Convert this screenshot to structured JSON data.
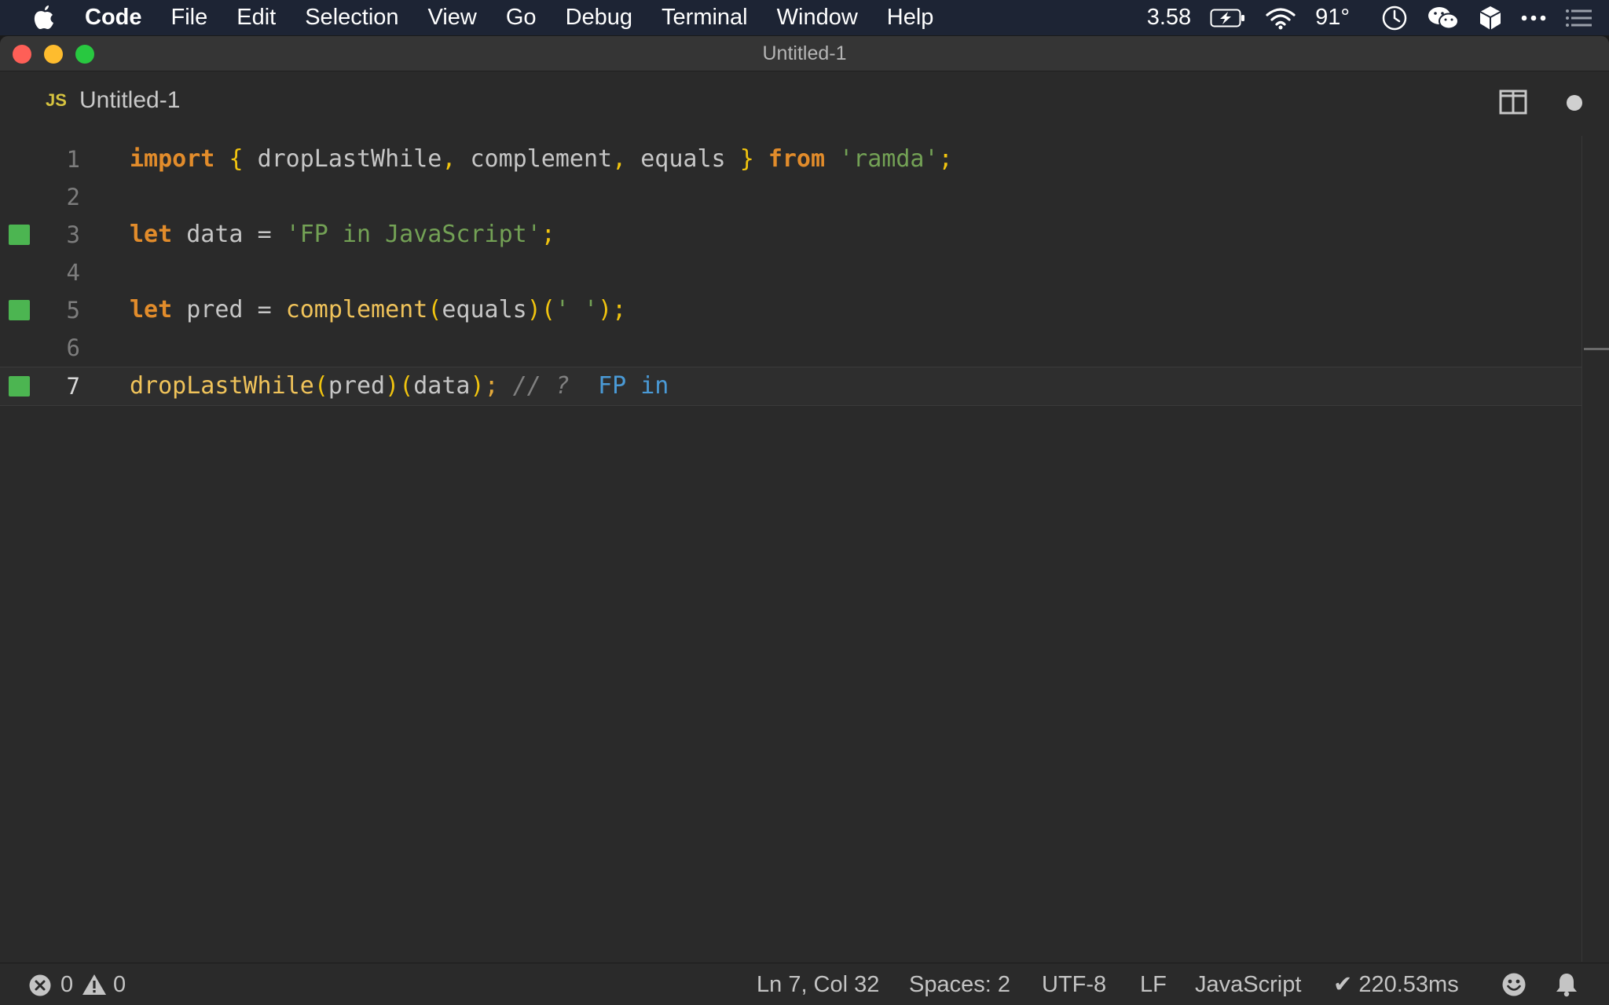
{
  "menubar": {
    "apple": "apple-icon",
    "items": [
      "Code",
      "File",
      "Edit",
      "Selection",
      "View",
      "Go",
      "Debug",
      "Terminal",
      "Window",
      "Help"
    ],
    "status_number": "3.58",
    "temperature": "91°"
  },
  "window": {
    "title": "Untitled-1"
  },
  "tab": {
    "language_badge": "JS",
    "name": "Untitled-1"
  },
  "editor": {
    "lines": [
      {
        "number": "1",
        "marker": false
      },
      {
        "number": "2",
        "marker": false
      },
      {
        "number": "3",
        "marker": true
      },
      {
        "number": "4",
        "marker": false
      },
      {
        "number": "5",
        "marker": true
      },
      {
        "number": "6",
        "marker": false
      },
      {
        "number": "7",
        "marker": true
      }
    ],
    "code": {
      "l1": {
        "import": "import",
        "lbrace": "{",
        "name1": "dropLastWhile",
        "comma1": ",",
        "name2": "complement",
        "comma2": ",",
        "name3": "equals",
        "rbrace": "}",
        "from": "from",
        "module": "'ramda'",
        "semi": ";"
      },
      "l3": {
        "let": "let",
        "var": "data",
        "eq": "=",
        "value": "'FP in JavaScript'",
        "semi": ";"
      },
      "l5": {
        "let": "let",
        "var": "pred",
        "eq": "=",
        "fn": "complement",
        "lp1": "(",
        "arg": "equals",
        "rp1": ")",
        "lp2": "(",
        "str": "' '",
        "rp2": ")",
        "semi": ";"
      },
      "l7": {
        "fn": "dropLastWhile",
        "lp1": "(",
        "arg1": "pred",
        "rp1": ")",
        "lp2": "(",
        "arg2": "data",
        "rp2": ")",
        "semi": ";",
        "comment": "// ?",
        "result": "FP in"
      }
    },
    "accent_marker_color": "#4cb551"
  },
  "statusbar": {
    "errors": "0",
    "warnings": "0",
    "position": "Ln 7, Col 32",
    "spaces": "Spaces: 2",
    "encoding": "UTF-8",
    "eol": "LF",
    "language": "JavaScript",
    "timing": "✔ 220.53ms"
  }
}
